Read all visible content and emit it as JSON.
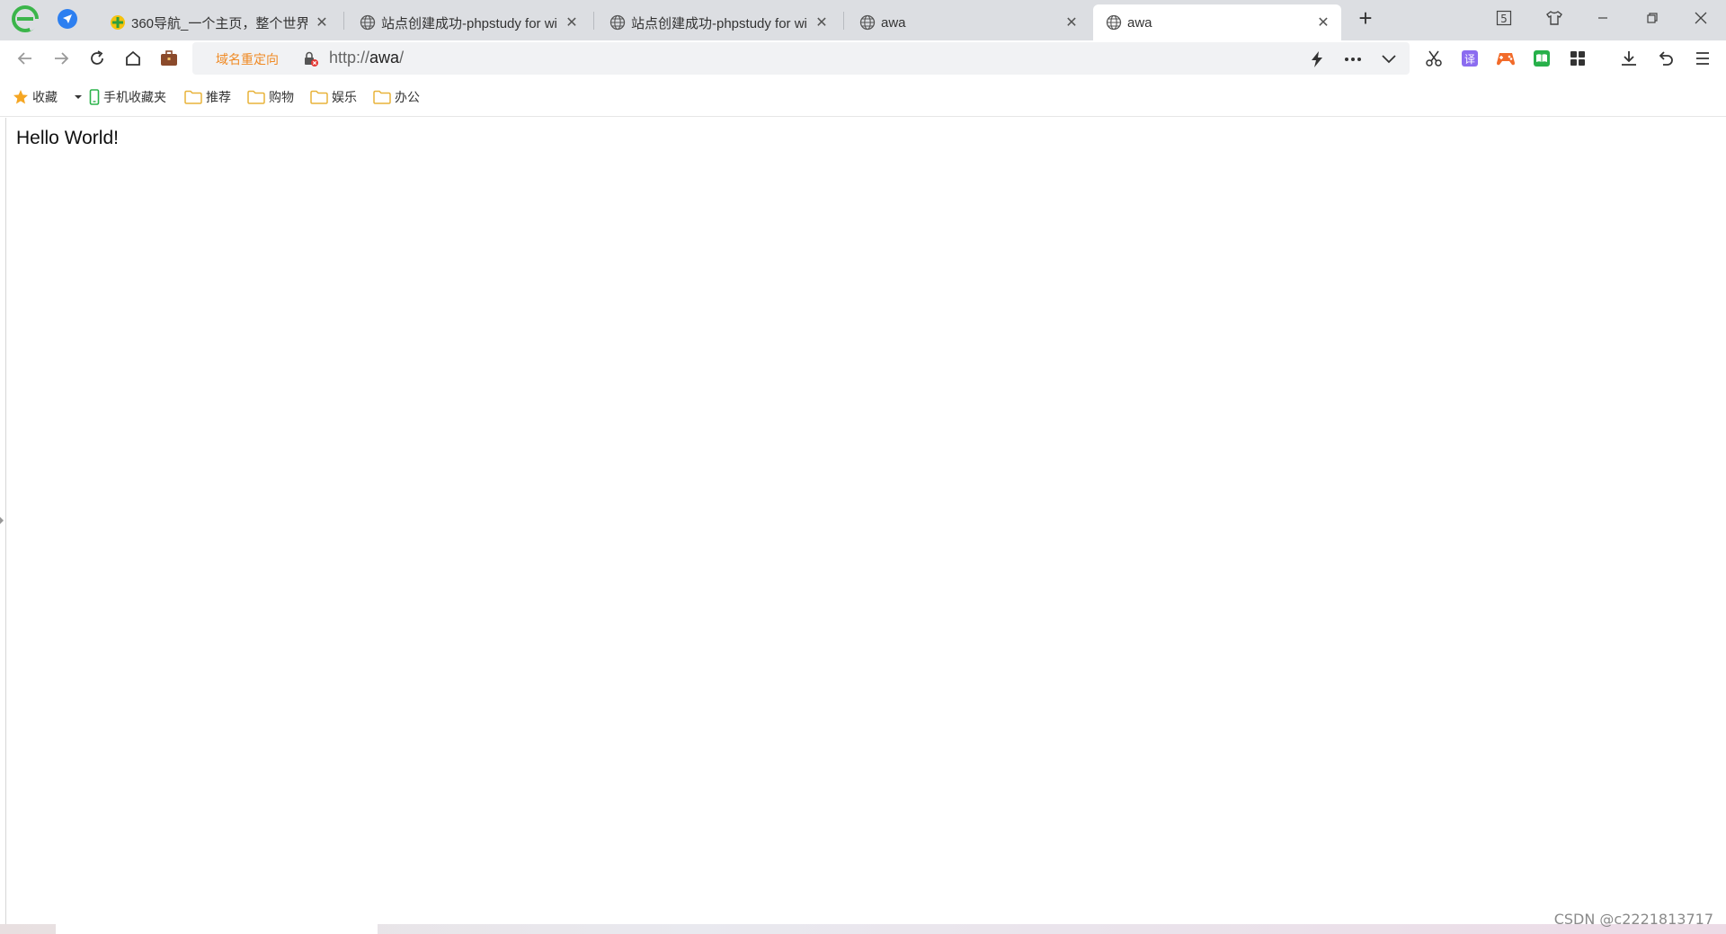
{
  "tabs": [
    {
      "label": "360导航_一个主页，整个世界",
      "favicon": "360-nav-icon",
      "active": false
    },
    {
      "label": "站点创建成功-phpstudy for windows",
      "favicon": "globe-icon",
      "active": false
    },
    {
      "label": "站点创建成功-phpstudy for windows",
      "favicon": "globe-icon",
      "active": false
    },
    {
      "label": "awa",
      "favicon": "globe-icon",
      "active": false
    },
    {
      "label": "awa",
      "favicon": "globe-icon",
      "active": true
    }
  ],
  "window": {
    "tab_count_badge": "5"
  },
  "address_bar": {
    "redirect_label": "域名重定向",
    "url_scheme": "http://",
    "url_host": "awa",
    "url_path": "/"
  },
  "bookmarks": [
    {
      "label": "收藏",
      "icon": "star-icon"
    },
    {
      "label": "手机收藏夹",
      "icon": "phone-icon"
    },
    {
      "label": "推荐",
      "icon": "folder-icon"
    },
    {
      "label": "购物",
      "icon": "folder-icon"
    },
    {
      "label": "娱乐",
      "icon": "folder-icon"
    },
    {
      "label": "办公",
      "icon": "folder-icon"
    }
  ],
  "page": {
    "body_text": "Hello World!"
  },
  "watermark": "CSDN @c2221813717",
  "colors": {
    "tabstrip": "#dcdee2",
    "accent_orange": "#f08a24",
    "star": "#f5a623",
    "folder": "#f6c94a"
  }
}
